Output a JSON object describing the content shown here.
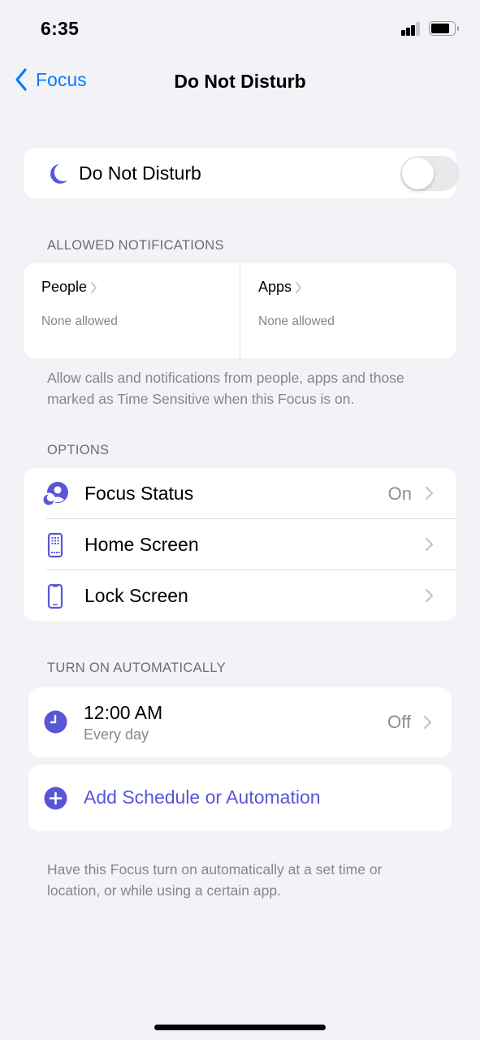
{
  "status_bar": {
    "time": "6:35",
    "signal_bars_active": 3,
    "signal_bars_total": 4,
    "battery_level": 0.8
  },
  "nav": {
    "back_label": "Focus",
    "title": "Do Not Disturb"
  },
  "focus_toggle": {
    "label": "Do Not Disturb",
    "icon": "moon-icon",
    "enabled": false
  },
  "allowed_notifications": {
    "header": "ALLOWED NOTIFICATIONS",
    "people": {
      "title": "People",
      "subtitle": "None allowed"
    },
    "apps": {
      "title": "Apps",
      "subtitle": "None allowed"
    },
    "footer": "Allow calls and notifications from people, apps and those marked as Time Sensitive when this Focus is on."
  },
  "options": {
    "header": "OPTIONS",
    "items": [
      {
        "label": "Focus Status",
        "value": "On",
        "icon": "focus-status-icon"
      },
      {
        "label": "Home Screen",
        "value": "",
        "icon": "home-screen-icon"
      },
      {
        "label": "Lock Screen",
        "value": "",
        "icon": "lock-screen-icon"
      }
    ]
  },
  "automation": {
    "header": "TURN ON AUTOMATICALLY",
    "schedule": {
      "time": "12:00 AM",
      "repeat": "Every day",
      "state": "Off",
      "icon": "clock-icon"
    },
    "add_label": "Add Schedule or Automation",
    "footer": "Have this Focus turn on automatically at a set time or location, or while using a certain app."
  },
  "colors": {
    "accent_blue": "#0a7aff",
    "focus_purple": "#5856d6",
    "background": "#f2f2f7"
  }
}
